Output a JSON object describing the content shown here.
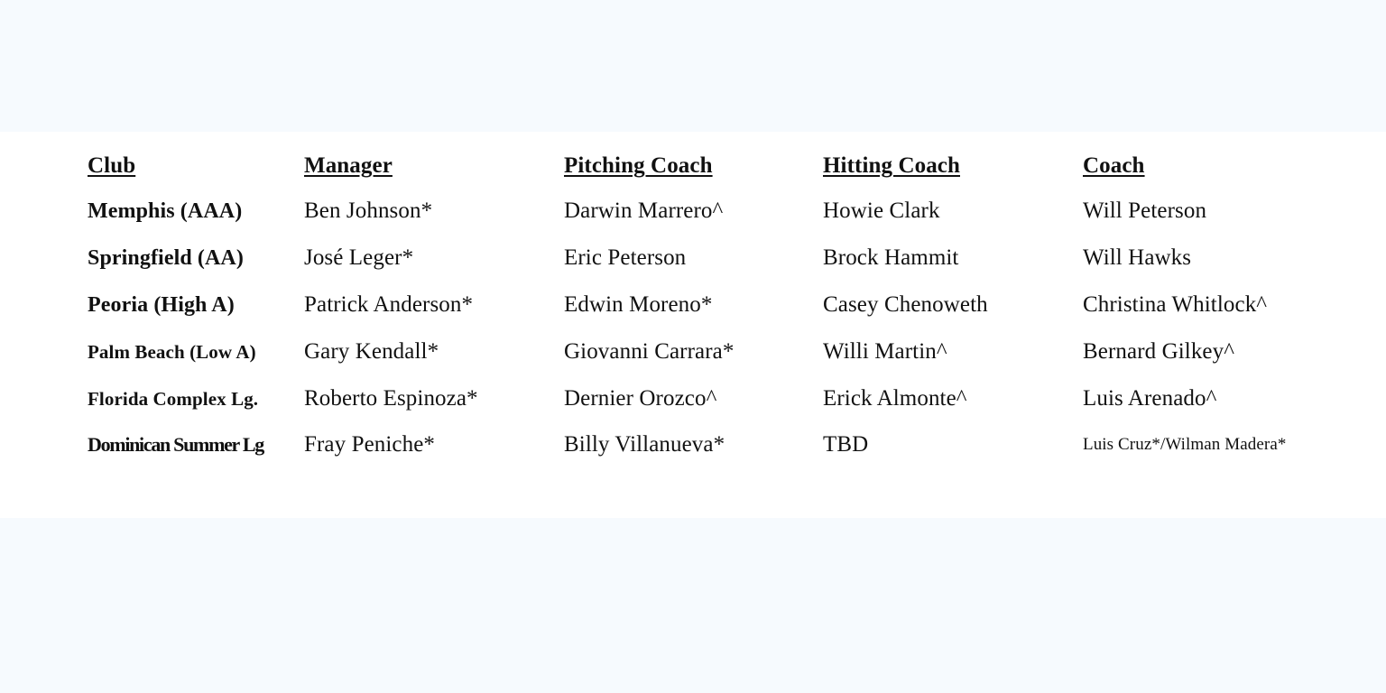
{
  "table": {
    "headers": [
      "Club",
      "Manager",
      "Pitching Coach",
      "Hitting Coach",
      "Coach"
    ],
    "rows": [
      {
        "club": "Memphis (AAA)",
        "manager": "Ben Johnson*",
        "pitching_coach": "Darwin Marrero^",
        "hitting_coach": "Howie Clark",
        "coach": "Will Peterson"
      },
      {
        "club": "Springfield (AA)",
        "manager": "José Leger*",
        "pitching_coach": "Eric Peterson",
        "hitting_coach": "Brock Hammit",
        "coach": "Will Hawks"
      },
      {
        "club": "Peoria (High A)",
        "manager": "Patrick Anderson*",
        "pitching_coach": "Edwin Moreno*",
        "hitting_coach": "Casey Chenoweth",
        "coach": "Christina Whitlock^"
      },
      {
        "club": "Palm Beach (Low A)",
        "manager": "Gary Kendall*",
        "pitching_coach": "Giovanni Carrara*",
        "hitting_coach": "Willi Martin^",
        "coach": "Bernard Gilkey^"
      },
      {
        "club": "Florida Complex Lg.",
        "manager": "Roberto Espinoza*",
        "pitching_coach": "Dernier Orozco^",
        "hitting_coach": "Erick Almonte^",
        "coach": "Luis Arenado^"
      },
      {
        "club": "Dominican Summer Lg",
        "manager": "Fray Peniche*",
        "pitching_coach": "Billy Villanueva*",
        "hitting_coach": "TBD",
        "coach": "Luis Cruz*/Wilman Madera*"
      }
    ]
  }
}
